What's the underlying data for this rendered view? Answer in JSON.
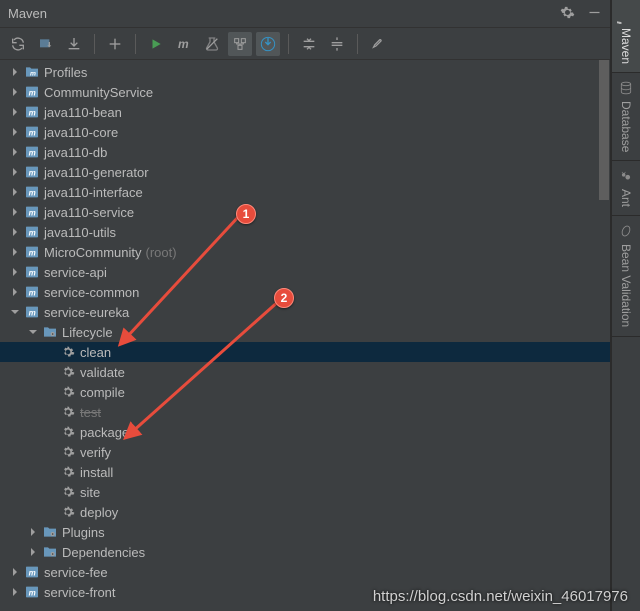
{
  "header": {
    "title": "Maven"
  },
  "tree": [
    {
      "depth": 0,
      "icon": "folder-m",
      "label": "Profiles",
      "expander": "closed"
    },
    {
      "depth": 0,
      "icon": "module-m",
      "label": "CommunityService",
      "expander": "closed"
    },
    {
      "depth": 0,
      "icon": "module-m",
      "label": "java110-bean",
      "expander": "closed"
    },
    {
      "depth": 0,
      "icon": "module-m",
      "label": "java110-core",
      "expander": "closed"
    },
    {
      "depth": 0,
      "icon": "module-m",
      "label": "java110-db",
      "expander": "closed"
    },
    {
      "depth": 0,
      "icon": "module-m",
      "label": "java110-generator",
      "expander": "closed"
    },
    {
      "depth": 0,
      "icon": "module-m",
      "label": "java110-interface",
      "expander": "closed"
    },
    {
      "depth": 0,
      "icon": "module-m",
      "label": "java110-service",
      "expander": "closed"
    },
    {
      "depth": 0,
      "icon": "module-m",
      "label": "java110-utils",
      "expander": "closed"
    },
    {
      "depth": 0,
      "icon": "module-m",
      "label": "MicroCommunity",
      "suffix": "(root)",
      "expander": "closed"
    },
    {
      "depth": 0,
      "icon": "module-m",
      "label": "service-api",
      "expander": "closed"
    },
    {
      "depth": 0,
      "icon": "module-m",
      "label": "service-common",
      "expander": "closed"
    },
    {
      "depth": 0,
      "icon": "module-m",
      "label": "service-eureka",
      "expander": "open"
    },
    {
      "depth": 1,
      "icon": "folder-gear",
      "label": "Lifecycle",
      "expander": "open"
    },
    {
      "depth": 2,
      "icon": "gear",
      "label": "clean",
      "expander": "none",
      "selected": true
    },
    {
      "depth": 2,
      "icon": "gear",
      "label": "validate",
      "expander": "none"
    },
    {
      "depth": 2,
      "icon": "gear",
      "label": "compile",
      "expander": "none"
    },
    {
      "depth": 2,
      "icon": "gear",
      "label": "test",
      "expander": "none",
      "muted": true
    },
    {
      "depth": 2,
      "icon": "gear",
      "label": "package",
      "expander": "none"
    },
    {
      "depth": 2,
      "icon": "gear",
      "label": "verify",
      "expander": "none"
    },
    {
      "depth": 2,
      "icon": "gear",
      "label": "install",
      "expander": "none"
    },
    {
      "depth": 2,
      "icon": "gear",
      "label": "site",
      "expander": "none"
    },
    {
      "depth": 2,
      "icon": "gear",
      "label": "deploy",
      "expander": "none"
    },
    {
      "depth": 1,
      "icon": "folder-gear",
      "label": "Plugins",
      "expander": "closed"
    },
    {
      "depth": 1,
      "icon": "folder-gear",
      "label": "Dependencies",
      "expander": "closed"
    },
    {
      "depth": 0,
      "icon": "module-m",
      "label": "service-fee",
      "expander": "closed"
    },
    {
      "depth": 0,
      "icon": "module-m",
      "label": "service-front",
      "expander": "closed"
    }
  ],
  "side_tabs": [
    {
      "label": "Maven",
      "icon": "m",
      "active": true
    },
    {
      "label": "Database",
      "icon": "db",
      "active": false
    },
    {
      "label": "Ant",
      "icon": "ant",
      "active": false
    },
    {
      "label": "Bean Validation",
      "icon": "bean",
      "active": false
    }
  ],
  "annotations": {
    "1": "1",
    "2": "2"
  },
  "watermark": "https://blog.csdn.net/weixin_46017976"
}
